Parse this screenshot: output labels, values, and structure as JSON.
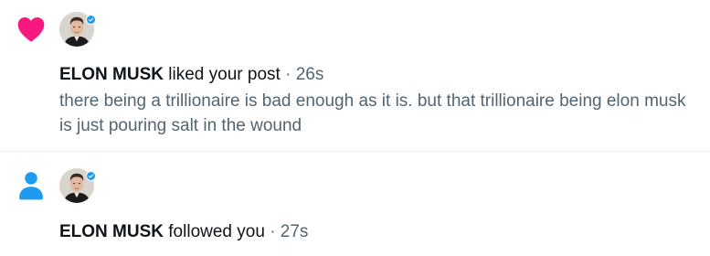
{
  "notifications": [
    {
      "type": "like",
      "icon": "heart-icon",
      "icon_color": "#f91880",
      "user_name": "ELON MUSK",
      "action": "liked your post",
      "separator": "·",
      "time": "26s",
      "preview": "there being a trillionaire is bad enough as it is. but that trillionaire being elon musk is just pouring salt in the wound",
      "verified": true
    },
    {
      "type": "follow",
      "icon": "person-icon",
      "icon_color": "#1d9bf0",
      "user_name": "ELON MUSK",
      "action": "followed you",
      "separator": "·",
      "time": "27s",
      "verified": true
    }
  ],
  "colors": {
    "verified_badge": "#1d9bf0",
    "secondary_text": "#536471",
    "primary_text": "#0f1419",
    "divider": "#eff3f4"
  }
}
